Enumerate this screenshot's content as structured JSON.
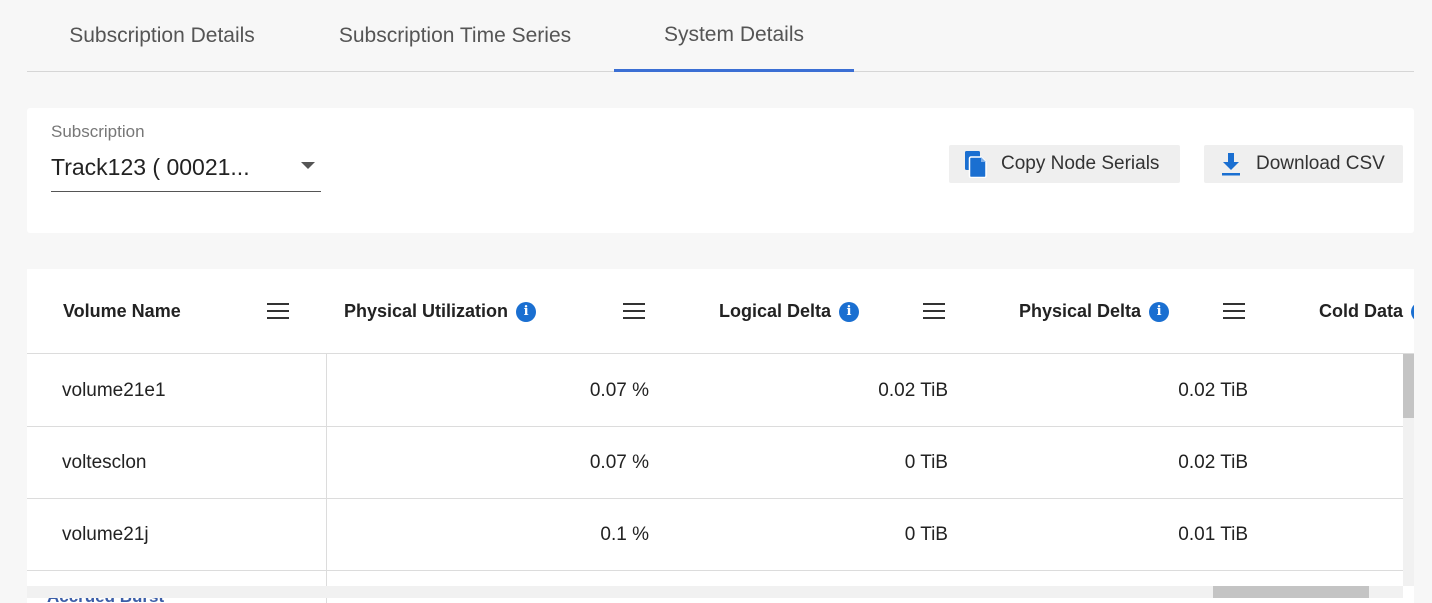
{
  "tabs": [
    {
      "label": "Subscription Details"
    },
    {
      "label": "Subscription Time Series"
    },
    {
      "label": "System Details"
    }
  ],
  "active_tab": "System Details",
  "accent_color": "#3b6fd4",
  "filter": {
    "label": "Subscription",
    "selected": "Track123 ( 00021..."
  },
  "actions": {
    "copy_label": "Copy Node Serials",
    "download_label": "Download CSV"
  },
  "table": {
    "columns": [
      {
        "label": "Volume Name",
        "info": false
      },
      {
        "label": "Physical Utilization",
        "info": true
      },
      {
        "label": "Logical Delta",
        "info": true
      },
      {
        "label": "Physical Delta",
        "info": true
      },
      {
        "label": "Cold Data",
        "info": true
      }
    ],
    "rows": [
      {
        "name": "volume21e1",
        "physical_utilization": "0.07 %",
        "logical_delta": "0.02 TiB",
        "physical_delta": "0.02 TiB"
      },
      {
        "name": "voltesclon",
        "physical_utilization": "0.07 %",
        "logical_delta": "0 TiB",
        "physical_delta": "0.02 TiB"
      },
      {
        "name": "volume21j",
        "physical_utilization": "0.1 %",
        "logical_delta": "0 TiB",
        "physical_delta": "0.01 TiB"
      }
    ],
    "partial_label": "Accrued Burst"
  }
}
